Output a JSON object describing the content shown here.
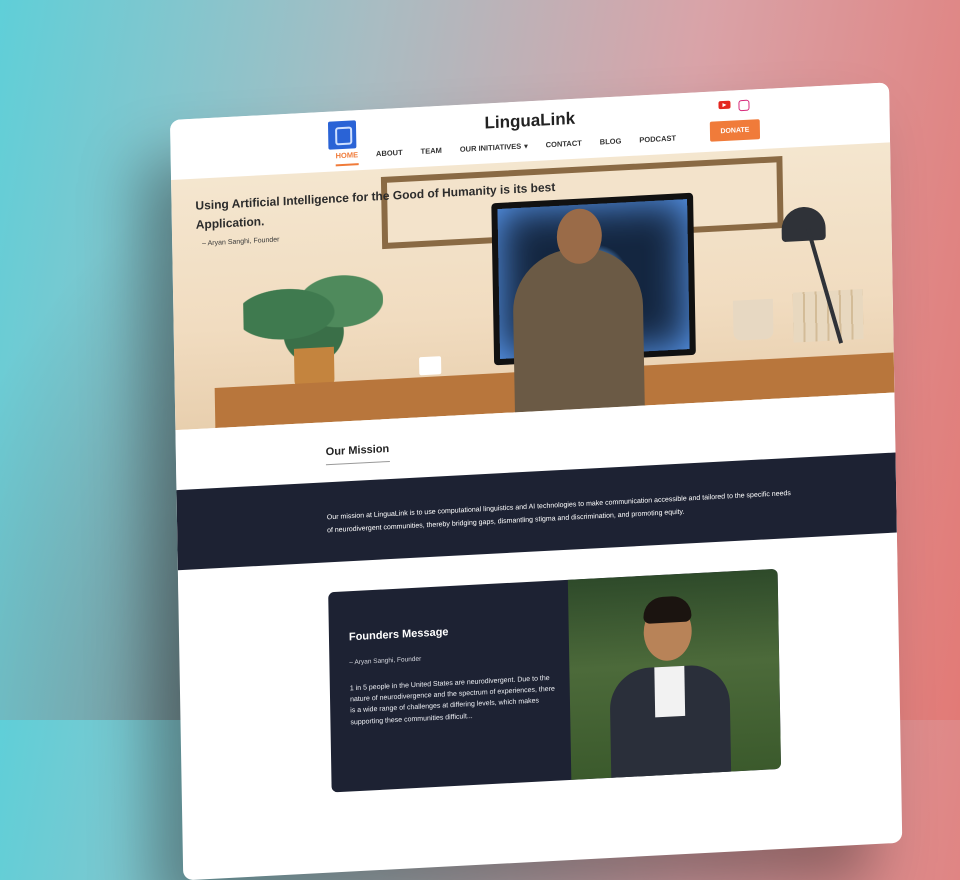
{
  "header": {
    "brand": "LinguaLink",
    "nav": [
      "HOME",
      "ABOUT",
      "TEAM",
      "OUR INITIATIVES",
      "CONTACT",
      "BLOG",
      "PODCAST"
    ],
    "active_nav": "HOME",
    "donate_label": "DONATE",
    "social_icons": [
      "youtube-icon",
      "instagram-icon"
    ]
  },
  "hero": {
    "quote": "Using Artificial Intelligence for the Good of Humanity is its best Application.",
    "author": "– Aryan Sanghi, Founder"
  },
  "mission": {
    "title": "Our Mission",
    "text": "Our mission at LinguaLink is to use computational linguistics and AI technologies to make communication accessible and tailored to the specific needs of neurodivergent communities, thereby bridging gaps, dismantling stigma and discrimination, and promoting equity."
  },
  "founders": {
    "title": "Founders Message",
    "author": "– Aryan Sanghi, Founder",
    "body": "1 in 5 people in the United States are neurodivergent. Due to the nature of neurodivergence and the spectrum of experiences, there is a wide range of challenges at differing levels, which makes supporting these communities difficult..."
  },
  "colors": {
    "accent": "#f07b3a",
    "band": "#1d2233"
  }
}
